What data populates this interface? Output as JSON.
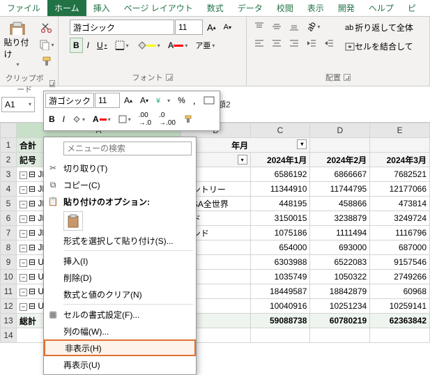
{
  "tabs": [
    "ファイル",
    "ホーム",
    "挿入",
    "ページ レイアウト",
    "数式",
    "データ",
    "校閲",
    "表示",
    "開発",
    "ヘルプ",
    "ピ"
  ],
  "active_tab": 1,
  "ribbon": {
    "clipboard": {
      "label": "クリップボード",
      "paste": "貼り付け"
    },
    "font": {
      "label": "フォント",
      "name": "游ゴシック",
      "size": "11",
      "bold": "B",
      "italic": "I",
      "underline": "U"
    },
    "align": {
      "label": "配置",
      "wrap": "折り返して全体",
      "merge": "セルを結合して"
    }
  },
  "namebox": "A1",
  "formula_tail": "額2",
  "mini": {
    "font": "游ゴシック",
    "size": "11"
  },
  "columns": [
    "A",
    "B",
    "C",
    "D",
    "E"
  ],
  "header_row": {
    "title": "年月"
  },
  "month_cols": [
    "2024年1月",
    "2024年2月",
    "2024年3月"
  ],
  "side_labels": {
    "gokei": "合計",
    "kigou": "記号"
  },
  "rows": [
    {
      "a": "⊟ JP",
      "b": "",
      "c": 6586192,
      "d": 6866667,
      "e": 7682521
    },
    {
      "a": "⊟ JP",
      "b": "カントリー",
      "c": 11344910,
      "d": 11744795,
      "e": 12177066
    },
    {
      "a": "⊟ JP",
      "b": "NISA全世界",
      "c": 448195,
      "d": 458866,
      "e": 473814
    },
    {
      "a": "⊟ JP",
      "b": "ンド",
      "c": 3150015,
      "d": 3238879,
      "e": 3249724
    },
    {
      "a": "⊟ JP",
      "b": "インド",
      "c": 1075186,
      "d": 1111494,
      "e": 1116796
    },
    {
      "a": "⊟ JP",
      "b": "ド",
      "c": 654000,
      "d": 693000,
      "e": 687000
    },
    {
      "a": "⊟ US",
      "b": "",
      "c": 6303988,
      "d": 6522083,
      "e": 9157546
    },
    {
      "a": "⊟ US",
      "b": "",
      "c": 1035749,
      "d": 1050322,
      "e": 2749266
    },
    {
      "a": "⊟ US",
      "b": "",
      "c": 18449587,
      "d": 18842879,
      "e": 60968
    },
    {
      "a": "⊟ US",
      "b": "",
      "c": 10040916,
      "d": 10251234,
      "e": 10259141
    }
  ],
  "total_row": {
    "label": "総計",
    "c": 59088738,
    "d": 60780219,
    "e": 62363842
  },
  "ctx": {
    "search_ph": "メニューの検索",
    "cut": "切り取り(T)",
    "copy": "コピー(C)",
    "paste_opts": "貼り付けのオプション:",
    "paste_special": "形式を選択して貼り付け(S)...",
    "insert": "挿入(I)",
    "delete": "削除(D)",
    "clear": "数式と値のクリア(N)",
    "format_cells": "セルの書式設定(F)...",
    "col_width": "列の幅(W)...",
    "hide": "非表示(H)",
    "unhide": "再表示(U)"
  }
}
